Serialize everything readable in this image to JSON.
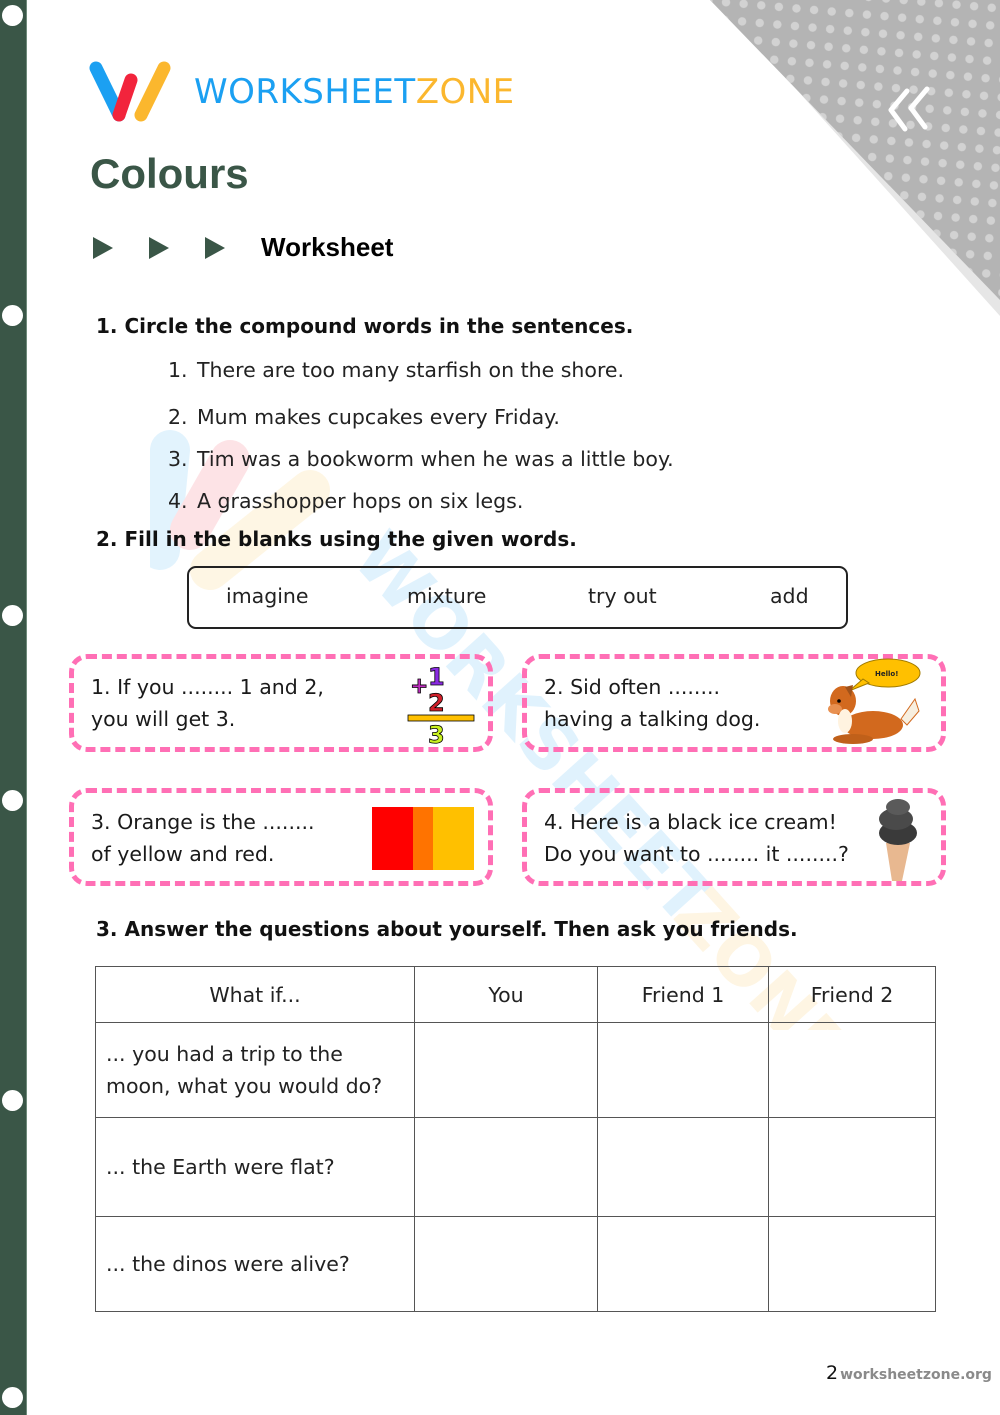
{
  "brand": {
    "part1": "WORKSHEET",
    "part2": "ZONE",
    "colors": {
      "blue": "#1ba0f2",
      "red": "#f2243c",
      "yellow": "#fbb72e",
      "green": "#3a5647"
    }
  },
  "title": "Colours",
  "subtitle": "Worksheet",
  "corner_icon": "double-chevron-left-icon",
  "section1": {
    "heading": "1. Circle the compound words in the sentences.",
    "items": [
      {
        "num": "1.",
        "text": "There are too many starfish on the shore."
      },
      {
        "num": "2.",
        "text": "Mum makes cupcakes every Friday."
      },
      {
        "num": "3.",
        "text": "Tim was a bookworm when he was a little boy."
      },
      {
        "num": "4.",
        "text": "A grasshopper hops on six legs."
      }
    ]
  },
  "section2": {
    "heading": "2. Fill in the blanks using the given words.",
    "words": [
      "imagine",
      "mixture",
      "try out",
      "add"
    ],
    "cards": [
      {
        "line1": "1. If you ........ 1 and 2,",
        "line2": "you will get 3.",
        "image": "addition-1-plus-2-equals-3"
      },
      {
        "line1": "2. Sid often ........",
        "line2": "having a talking dog.",
        "image": "talking-dog",
        "bubble": "Hello!"
      },
      {
        "line1": "3. Orange is the ........",
        "line2": "of yellow and red.",
        "image": "color-swatch-red-orange-yellow",
        "swatch_colors": [
          "#ff0000",
          "#ff7300",
          "#ffc000"
        ]
      },
      {
        "line1": "4. Here is a black ice cream!",
        "line2": "Do you want to ........ it ........?",
        "image": "black-ice-cream"
      }
    ]
  },
  "section3": {
    "heading": "3. Answer the questions about yourself. Then ask you friends.",
    "columns": [
      "What if...",
      "You",
      "Friend 1",
      "Friend 2"
    ],
    "rows": [
      {
        "q1": "... you had a trip to the",
        "q2": "moon, what you would do?"
      },
      {
        "q1": "... the Earth were flat?",
        "q2": ""
      },
      {
        "q1": "... the dinos were alive?",
        "q2": ""
      }
    ]
  },
  "footer": {
    "page": "2",
    "site": "worksheetzone.org"
  }
}
